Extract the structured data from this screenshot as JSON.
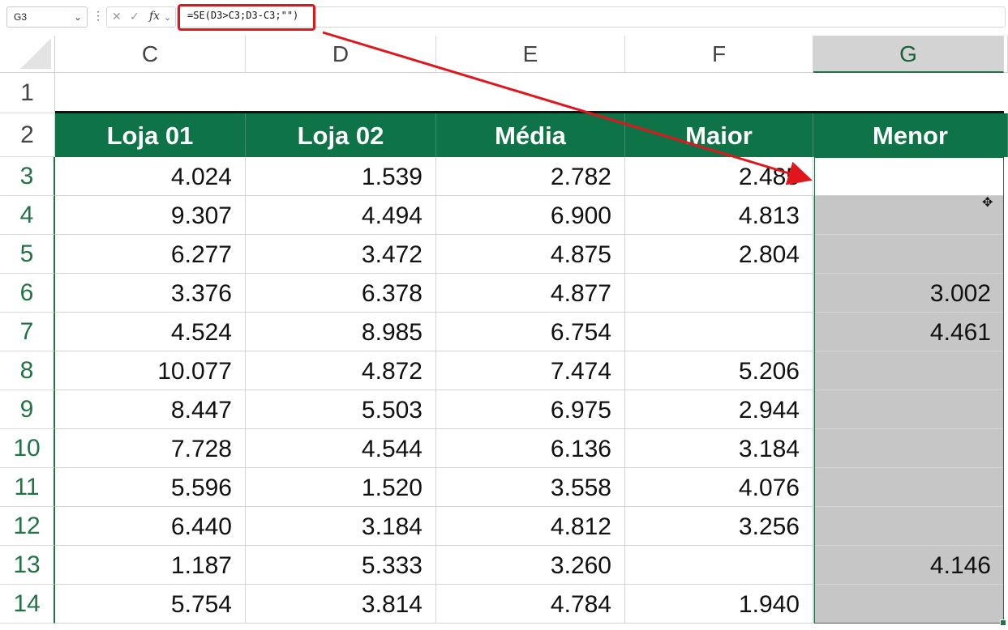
{
  "namebox": {
    "value": "G3",
    "dropdown_icon": "chevron-down-icon"
  },
  "formula_bar": {
    "cancel_icon": "close-icon",
    "enter_icon": "check-icon",
    "fx_label": "fx",
    "formula": "=SE(D3>C3;D3-C3;\"\")",
    "highlight_color": "#e0161b"
  },
  "columns": [
    "C",
    "D",
    "E",
    "F",
    "G"
  ],
  "selected_column": "G",
  "rows": [
    "1",
    "2",
    "3",
    "4",
    "5",
    "6",
    "7",
    "8",
    "9",
    "10",
    "11",
    "12",
    "13",
    "14"
  ],
  "header_fill": "#0e7448",
  "table": {
    "headers": [
      "Loja 01",
      "Loja 02",
      "Média",
      "Maior",
      "Menor"
    ],
    "data": [
      [
        "4.024",
        "1.539",
        "2.782",
        "2.485",
        ""
      ],
      [
        "9.307",
        "4.494",
        "6.900",
        "4.813",
        ""
      ],
      [
        "6.277",
        "3.472",
        "4.875",
        "2.804",
        ""
      ],
      [
        "3.376",
        "6.378",
        "4.877",
        "",
        "3.002"
      ],
      [
        "4.524",
        "8.985",
        "6.754",
        "",
        "4.461"
      ],
      [
        "10.077",
        "4.872",
        "7.474",
        "5.206",
        ""
      ],
      [
        "8.447",
        "5.503",
        "6.975",
        "2.944",
        ""
      ],
      [
        "7.728",
        "4.544",
        "6.136",
        "3.184",
        ""
      ],
      [
        "5.596",
        "1.520",
        "3.558",
        "4.076",
        ""
      ],
      [
        "6.440",
        "3.184",
        "4.812",
        "3.256",
        ""
      ],
      [
        "1.187",
        "5.333",
        "3.260",
        "",
        "4.146"
      ],
      [
        "5.754",
        "3.814",
        "4.784",
        "1.940",
        ""
      ]
    ]
  },
  "arrow_color": "#e0161b"
}
